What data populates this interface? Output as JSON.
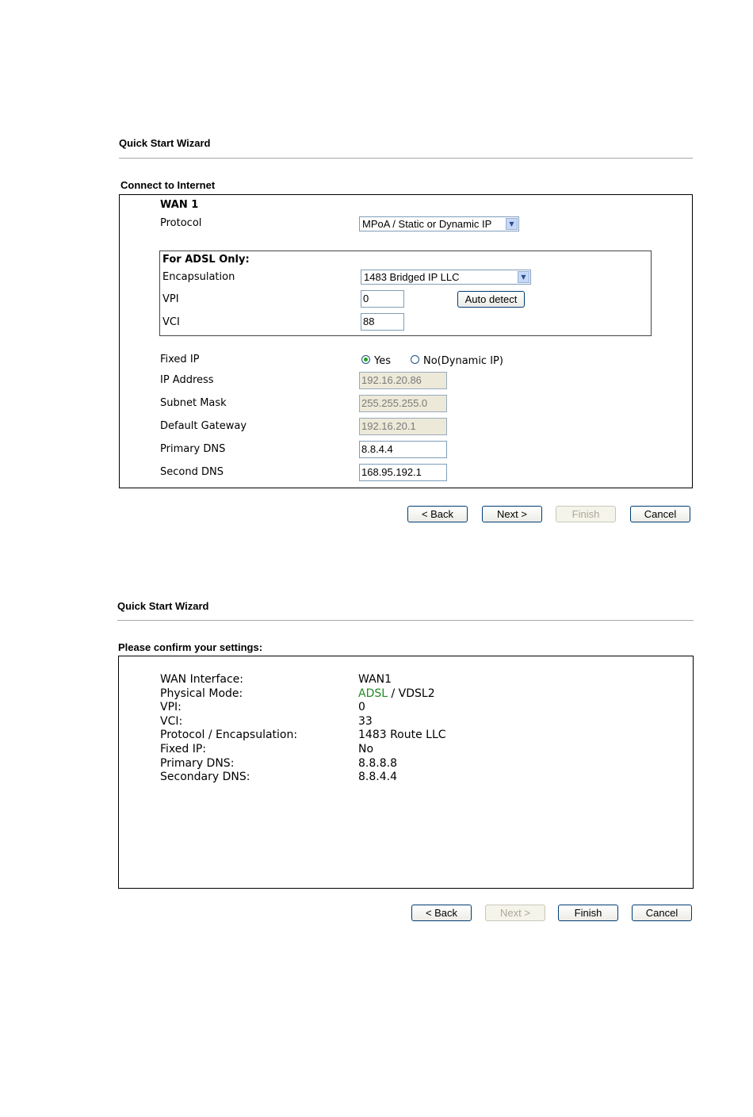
{
  "panel1": {
    "header": "Quick Start Wizard",
    "section_title": "Connect to Internet",
    "wan_label": "WAN 1",
    "protocol_label": "Protocol",
    "protocol_value": "MPoA / Static or Dynamic IP",
    "adsl_group_title": "For ADSL Only:",
    "encapsulation_label": "Encapsulation",
    "encapsulation_value": "1483 Bridged IP LLC",
    "vpi_label": "VPI",
    "vpi_value": "0",
    "auto_detect_label": "Auto detect",
    "vci_label": "VCI",
    "vci_value": "88",
    "fixed_ip_label": "Fixed IP",
    "fixed_ip_yes": "Yes",
    "fixed_ip_no": "No(Dynamic IP)",
    "ip_address_label": "IP Address",
    "ip_address_value": "192.16.20.86",
    "subnet_mask_label": "Subnet Mask",
    "subnet_mask_value": "255.255.255.0",
    "default_gateway_label": "Default Gateway",
    "default_gateway_value": "192.16.20.1",
    "primary_dns_label": "Primary DNS",
    "primary_dns_value": "8.8.4.4",
    "second_dns_label": "Second DNS",
    "second_dns_value": "168.95.192.1",
    "buttons": {
      "back": "< Back",
      "next": "Next >",
      "finish": "Finish",
      "cancel": "Cancel"
    }
  },
  "panel2": {
    "header": "Quick Start Wizard",
    "section_title": "Please confirm your settings:",
    "rows": [
      {
        "label": "WAN Interface:",
        "value": "WAN1"
      },
      {
        "label": "Physical Mode:",
        "value_highlight": "ADSL",
        "value_rest": " / VDSL2"
      },
      {
        "label": "VPI:",
        "value": "0"
      },
      {
        "label": "VCI:",
        "value": "33"
      },
      {
        "label": "Protocol / Encapsulation:",
        "value": "1483 Route LLC"
      },
      {
        "label": "Fixed IP:",
        "value": "No"
      },
      {
        "label": "Primary DNS:",
        "value": "8.8.8.8"
      },
      {
        "label": "Secondary DNS:",
        "value": "8.8.4.4"
      }
    ],
    "buttons": {
      "back": "< Back",
      "next": "Next >",
      "finish": "Finish",
      "cancel": "Cancel"
    }
  },
  "colors": {
    "highlight": "#218a21",
    "border": "#000000",
    "divider": "#a8a8a8"
  }
}
